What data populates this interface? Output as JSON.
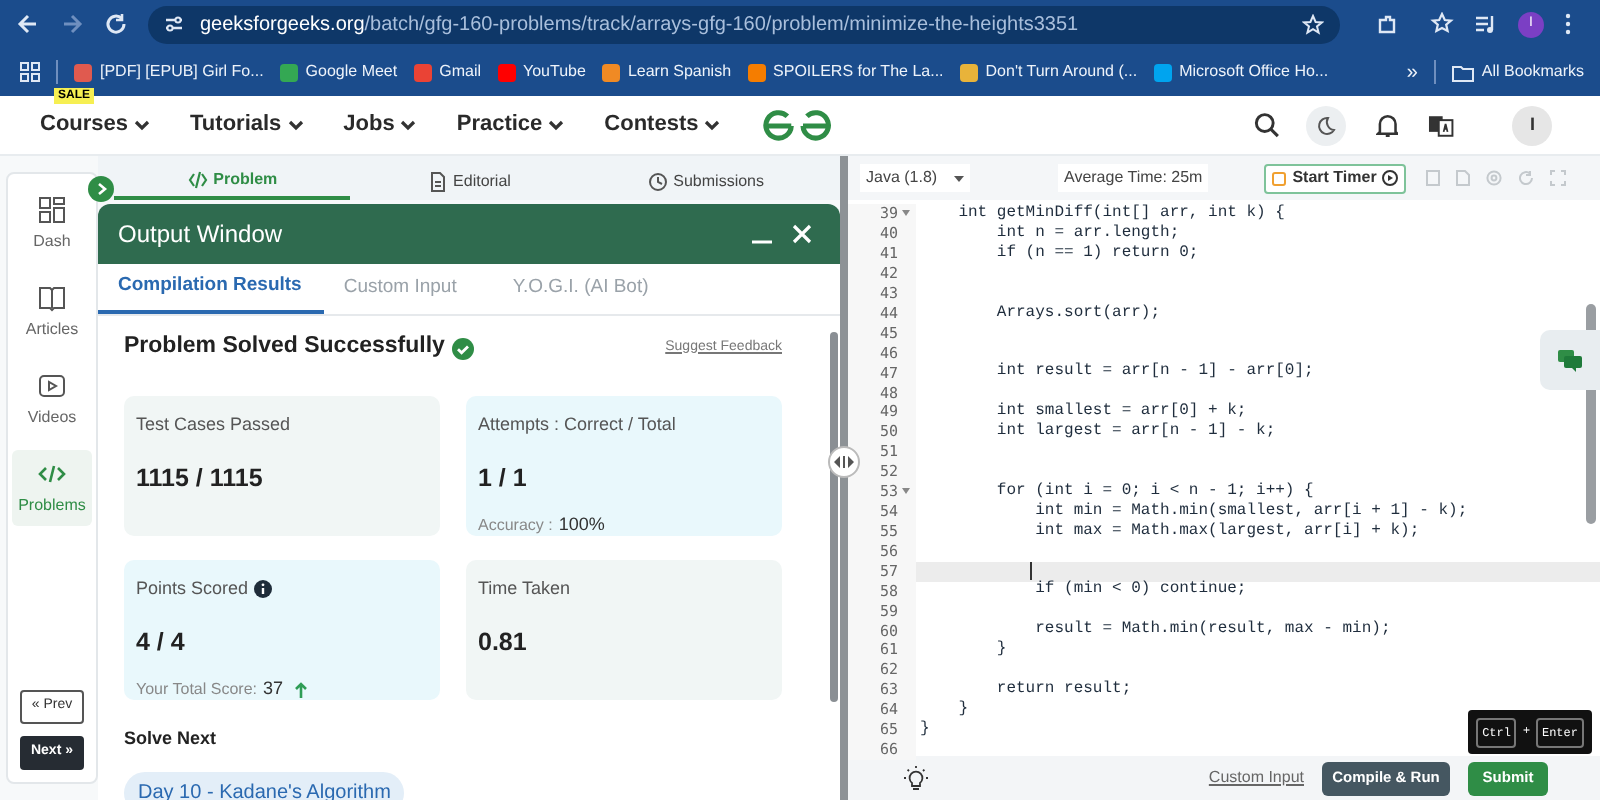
{
  "browser": {
    "url_host": "geeksforgeeks.org",
    "url_path": "/batch/gfg-160-problems/track/arrays-gfg-160/problem/minimize-the-heights3351",
    "profile_initial": "I",
    "bookmarks": [
      {
        "label": "[PDF] [EPUB] Girl Fo...",
        "color": "#e05a4f"
      },
      {
        "label": "Google Meet",
        "color": "#34a853"
      },
      {
        "label": "Gmail",
        "color": "#ea4335"
      },
      {
        "label": "YouTube",
        "color": "#ff0000"
      },
      {
        "label": "Learn Spanish",
        "color": "#f08a24"
      },
      {
        "label": "SPOILERS for The La...",
        "color": "#f57d00"
      },
      {
        "label": "Don't Turn Around (...",
        "color": "#e8b33a"
      },
      {
        "label": "Microsoft Office Ho...",
        "color": "#00a4ef"
      }
    ],
    "overflow": "»",
    "all_bookmarks": "All Bookmarks"
  },
  "nav": {
    "sale_badge": "SALE",
    "items": [
      "Courses",
      "Tutorials",
      "Jobs",
      "Practice",
      "Contests"
    ],
    "avatar": "I"
  },
  "sidebar": {
    "items": [
      {
        "label": "Dash",
        "kind": "dash",
        "selected": false
      },
      {
        "label": "Articles",
        "kind": "articles",
        "selected": false
      },
      {
        "label": "Videos",
        "kind": "videos",
        "selected": false
      },
      {
        "label": "Problems",
        "kind": "problems",
        "selected": true
      }
    ],
    "prev": "« Prev",
    "next": "Next »"
  },
  "problem_tabs": [
    {
      "label": "Problem",
      "kind": "code",
      "selected": true
    },
    {
      "label": "Editorial",
      "kind": "doc",
      "selected": false
    },
    {
      "label": "Submissions",
      "kind": "clock",
      "selected": false
    }
  ],
  "output_window": {
    "title": "Output Window",
    "tabs": [
      {
        "label": "Compilation Results",
        "selected": true
      },
      {
        "label": "Custom Input",
        "selected": false
      },
      {
        "label": "Y.O.G.I. (AI Bot)",
        "selected": false
      }
    ],
    "status": "Problem Solved Successfully",
    "feedback": "Suggest Feedback",
    "cards": [
      {
        "label": "Test Cases Passed",
        "value": "1115 / 1115",
        "color": "#f1f6f5",
        "info": false
      },
      {
        "label": "Attempts : Correct / Total",
        "value": "1 / 1",
        "note_label": "Accuracy :",
        "note_value": "100%",
        "color": "#e9f8fc",
        "info": false
      },
      {
        "label": "Points Scored",
        "value": "4 / 4",
        "note_label": "Your Total Score:",
        "note_value": "37",
        "trending_up": true,
        "color": "#e9f8fc",
        "info": true
      },
      {
        "label": "Time Taken",
        "value": "0.81",
        "color": "#f1f6f5",
        "info": false
      }
    ],
    "solve_next": "Solve Next",
    "next_chip": "Day 10 - Kadane's Algorithm"
  },
  "editor": {
    "language": "Java (1.8)",
    "average_time": "Average Time: 25m",
    "timer": "Start Timer",
    "lines": [
      {
        "n": "39",
        "code": "    int getMinDiff(int[] arr, int k) {",
        "fold": true,
        "current": false
      },
      {
        "n": "40",
        "code": "        int n = arr.length;",
        "fold": false,
        "current": false
      },
      {
        "n": "41",
        "code": "        if (n == 1) return 0;",
        "fold": false,
        "current": false
      },
      {
        "n": "42",
        "fold": false,
        "current": false
      },
      {
        "n": "43",
        "fold": false,
        "current": false
      },
      {
        "n": "44",
        "code": "        Arrays.sort(arr);",
        "fold": false,
        "current": false
      },
      {
        "n": "45",
        "fold": false,
        "current": false
      },
      {
        "n": "46",
        "fold": false,
        "current": false
      },
      {
        "n": "47",
        "code": "        int result = arr[n - 1] - arr[0];",
        "fold": false,
        "current": false
      },
      {
        "n": "48",
        "fold": false,
        "current": false
      },
      {
        "n": "49",
        "code": "        int smallest = arr[0] + k;",
        "fold": false,
        "current": false
      },
      {
        "n": "50",
        "code": "        int largest = arr[n - 1] - k;",
        "fold": false,
        "current": false
      },
      {
        "n": "51",
        "fold": false,
        "current": false
      },
      {
        "n": "52",
        "fold": false,
        "current": false
      },
      {
        "n": "53",
        "code": "        for (int i = 0; i < n - 1; i++) {",
        "fold": true,
        "current": false
      },
      {
        "n": "54",
        "code": "            int min = Math.min(smallest, arr[i + 1] - k);",
        "fold": false,
        "current": false
      },
      {
        "n": "55",
        "code": "            int max = Math.max(largest, arr[i] + k);",
        "fold": false,
        "current": false
      },
      {
        "n": "56",
        "fold": false,
        "current": false
      },
      {
        "n": "57",
        "fold": false,
        "current": true
      },
      {
        "n": "58",
        "code": "            if (min < 0) continue;",
        "fold": false,
        "current": false
      },
      {
        "n": "59",
        "fold": false,
        "current": false
      },
      {
        "n": "60",
        "code": "            result = Math.min(result, max - min);",
        "fold": false,
        "current": false
      },
      {
        "n": "61",
        "code": "        }",
        "fold": false,
        "current": false
      },
      {
        "n": "62",
        "fold": false,
        "current": false
      },
      {
        "n": "63",
        "code": "        return result;",
        "fold": false,
        "current": false
      },
      {
        "n": "64",
        "code": "    }",
        "fold": false,
        "current": false
      },
      {
        "n": "65",
        "code": "}",
        "fold": false,
        "current": false
      },
      {
        "n": "66",
        "fold": false,
        "current": false
      }
    ],
    "custom_input": "Custom Input",
    "compile": "Compile & Run",
    "submit": "Submit",
    "shortcut": {
      "keys": [
        "Ctrl",
        "Enter"
      ],
      "joiner": "+"
    }
  }
}
